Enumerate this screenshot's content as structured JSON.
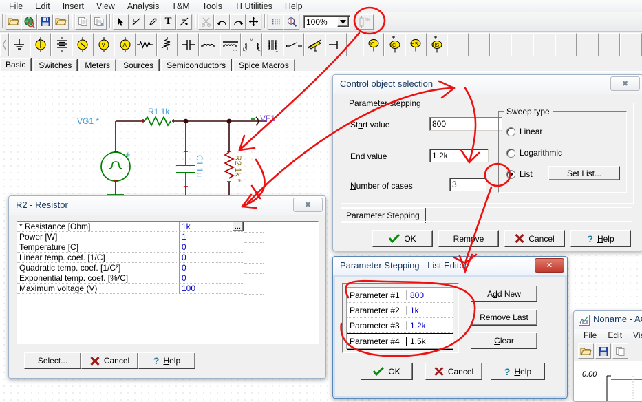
{
  "app": {
    "menu": [
      "File",
      "Edit",
      "Insert",
      "View",
      "Analysis",
      "T&M",
      "Tools",
      "TI Utilities",
      "Help"
    ],
    "zoom_value": "100%",
    "toolbar_icons": [
      "open-folder-icon",
      "globe-search-icon",
      "save-disk-icon",
      "open-folder-2-icon",
      "copy-icon",
      "paste-icon",
      "arrow-select-icon",
      "wire-icon",
      "pencil-icon",
      "text-tool-icon",
      "graph-tool-icon",
      "cut-scissors-icon",
      "undo-icon",
      "redo-icon",
      "crosshair-icon",
      "grid-icon",
      "zoom-in-icon",
      "component-1k-icon"
    ],
    "component_icons": [
      "ground-icon",
      "current-source-icon",
      "battery-icon",
      "voltage-source-icon",
      "voltmeter-icon",
      "ammeter-icon",
      "resistor-icon",
      "potentiometer-icon",
      "capacitor-icon",
      "inductor-icon",
      "coil-core-icon",
      "coupled-inductor-icon",
      "transformer-icon",
      "switch-icon",
      "variable-resistor-icon",
      "terminal-icon",
      "ic-node-icon",
      "ic-plus-node-icon",
      "hs-node-icon",
      "hs-plus-node-icon"
    ],
    "component_tabs": [
      "Basic",
      "Switches",
      "Meters",
      "Sources",
      "Semiconductors",
      "Spice Macros"
    ],
    "active_component_tab": "Basic"
  },
  "schematic": {
    "labels": [
      {
        "name": "r1-label",
        "text": "R1 1k"
      },
      {
        "name": "vg1-label",
        "text": "VG1 *"
      },
      {
        "name": "c1-label",
        "text": "C1 1u"
      },
      {
        "name": "r2-label",
        "text": "R2 1k *"
      },
      {
        "name": "vf1-label",
        "text": "VF1"
      }
    ],
    "colors": {
      "wire": "#3a0b0b",
      "component": "#008000",
      "label": "#3b9ad9",
      "node_label": "#7b4fcf",
      "ref_label": "#8a6d1b"
    }
  },
  "control_dialog": {
    "title": "Control object selection",
    "close_glyph": "✖",
    "group_title": "Parameter stepping",
    "fields": [
      {
        "label": "Start value",
        "label_accel": "a",
        "value": "800"
      },
      {
        "label": "End value",
        "label_accel": "E",
        "value": "1.2k"
      },
      {
        "label": "Number of cases",
        "label_accel": "N",
        "value": "3"
      }
    ],
    "sweep": {
      "group_title": "Sweep type",
      "options": [
        {
          "label": "Linear",
          "selected": false
        },
        {
          "label": "Logarithmic",
          "selected": false
        },
        {
          "label": "List",
          "selected": true
        }
      ],
      "set_list_button": "Set List..."
    },
    "tab": "Parameter Stepping",
    "buttons": [
      {
        "name": "ok-button",
        "label": "OK",
        "icon": "green-check-icon"
      },
      {
        "name": "remove-button",
        "label": "Remove",
        "icon": ""
      },
      {
        "name": "cancel-button",
        "label": "Cancel",
        "icon": "red-x-icon"
      },
      {
        "name": "help-button",
        "label": "Help",
        "icon": "blue-question-icon"
      }
    ]
  },
  "resistor_dialog": {
    "title": "R2 - Resistor",
    "close_glyph": "✖",
    "rows": [
      {
        "name": "* Resistance [Ohm]",
        "value": "1k",
        "has_ellipsis": true
      },
      {
        "name": "Power       [W]",
        "value": "1",
        "has_ellipsis": false
      },
      {
        "name": "Temperature [C]",
        "value": "0",
        "has_ellipsis": false
      },
      {
        "name": "Linear temp. coef. [1/C]",
        "value": "0",
        "has_ellipsis": false
      },
      {
        "name": "Quadratic temp. coef. [1/C²]",
        "value": "0",
        "has_ellipsis": false
      },
      {
        "name": "Exponential temp. coef. [%/C]",
        "value": "0",
        "has_ellipsis": false
      },
      {
        "name": "Maximum voltage (V)",
        "value": "100",
        "has_ellipsis": false
      }
    ],
    "ellipsis_label": "...",
    "buttons": [
      {
        "name": "select-button",
        "label": "Select...",
        "icon": ""
      },
      {
        "name": "cancel-button",
        "label": "Cancel",
        "icon": "red-x-icon"
      },
      {
        "name": "help-button",
        "label": "Help",
        "icon": "blue-question-icon"
      }
    ]
  },
  "list_editor": {
    "title": "Parameter Stepping - List Editor",
    "close_glyph": "✕",
    "rows": [
      {
        "label": "Parameter #1",
        "value": "800",
        "editing": false
      },
      {
        "label": "Parameter #2",
        "value": "1k",
        "editing": false
      },
      {
        "label": "Parameter #3",
        "value": "1.2k",
        "editing": false
      },
      {
        "label": "Parameter #4",
        "value": "1.5k",
        "editing": true
      }
    ],
    "side_buttons": [
      {
        "name": "add-new-button",
        "label": "Add New"
      },
      {
        "name": "remove-last-button",
        "label": "Remove Last"
      },
      {
        "name": "clear-button",
        "label": "Clear"
      }
    ],
    "buttons": [
      {
        "name": "ok-button",
        "label": "OK",
        "icon": "green-check-icon"
      },
      {
        "name": "cancel-button",
        "label": "Cancel",
        "icon": "red-x-icon"
      },
      {
        "name": "help-button",
        "label": "Help",
        "icon": "blue-question-icon"
      }
    ]
  },
  "plot_window": {
    "title": "Noname - AC",
    "menu": [
      "File",
      "Edit",
      "View"
    ],
    "axis_label": "0.00",
    "icons": [
      "open-folder-icon",
      "save-disk-icon",
      "copy-icon"
    ]
  },
  "annotation": {
    "color": "#ee1111"
  }
}
